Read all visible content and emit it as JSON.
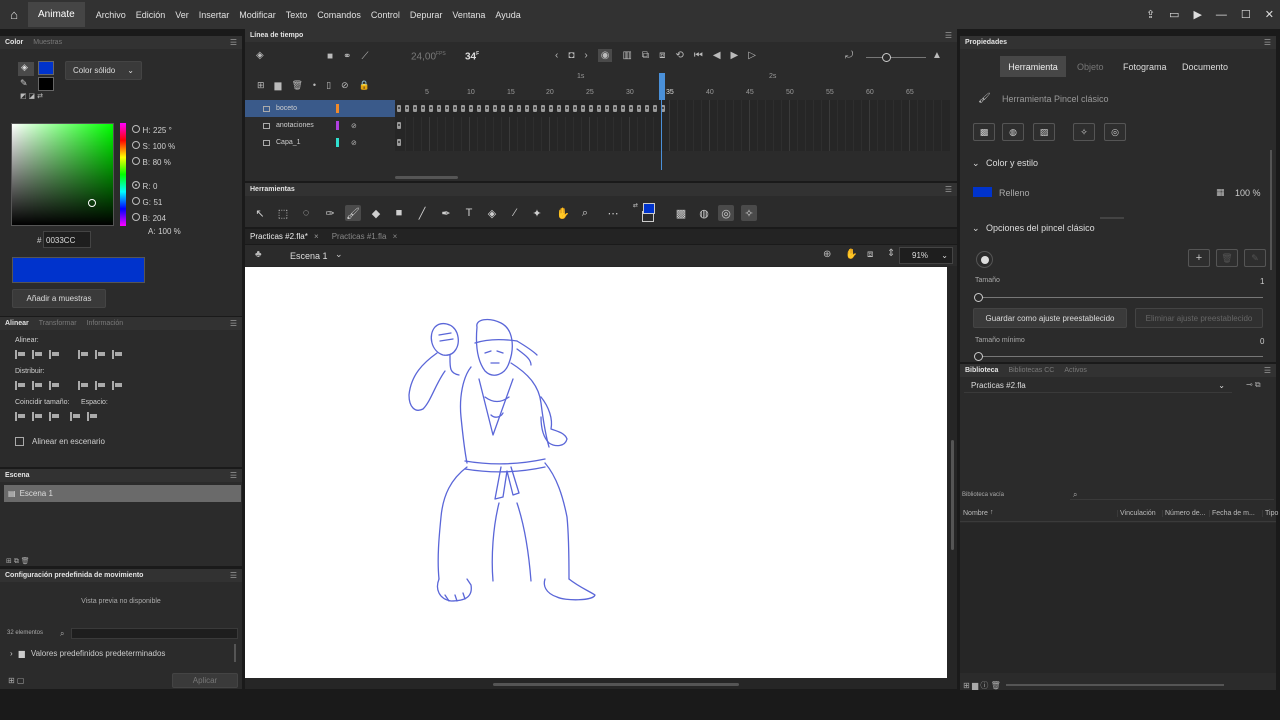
{
  "menubar": {
    "app_name": "Animate",
    "items": [
      "Archivo",
      "Edición",
      "Ver",
      "Insertar",
      "Modificar",
      "Texto",
      "Comandos",
      "Control",
      "Depurar",
      "Ventana",
      "Ayuda"
    ]
  },
  "color_panel": {
    "tabs": [
      "Color",
      "Muestras"
    ],
    "fill_type": "Color sólido",
    "hsb": {
      "h_label": "H:",
      "h": "225 °",
      "s_label": "S:",
      "s": "100 %",
      "b_label": "B:",
      "b": "80 %"
    },
    "rgb": {
      "r_label": "R:",
      "r": "0",
      "g_label": "G:",
      "g": "51",
      "b_label": "B:",
      "b": "204",
      "a_label": "A:",
      "a": "100 %"
    },
    "hex_prefix": "#",
    "hex": "0033CC",
    "add_button": "Añadir a muestras",
    "fill_color": "#0033cc"
  },
  "align_panel": {
    "tabs": [
      "Alinear",
      "Transformar",
      "Información"
    ],
    "align_label": "Alinear:",
    "distribute_label": "Distribuir:",
    "match_label": "Coincidir tamaño:",
    "space_label": "Espacio:",
    "stage_checkbox": "Alinear en escenario"
  },
  "scene_panel": {
    "title": "Escena",
    "items": [
      "Escena 1"
    ]
  },
  "motion_panel": {
    "title": "Configuración predefinida de movimiento",
    "preview": "Vista previa no disponible",
    "count": "32 elementos",
    "folder": "Valores predefinidos predeterminados",
    "apply": "Aplicar"
  },
  "timeline": {
    "title": "Línea de tiempo",
    "fps": "24,00",
    "fps_unit": "FPS",
    "frame": "34",
    "frame_unit": "F",
    "sec_marks": [
      "1s",
      "2s"
    ],
    "numbers": [
      "5",
      "10",
      "15",
      "20",
      "25",
      "30",
      "35",
      "40",
      "45",
      "50",
      "55",
      "60",
      "65"
    ],
    "layers": [
      {
        "name": "boceto",
        "color": "#f08a2a"
      },
      {
        "name": "anotaciones",
        "color": "#b040e0"
      },
      {
        "name": "Capa_1",
        "color": "#30e0d0"
      }
    ]
  },
  "tools_panel": {
    "title": "Herramientas",
    "stroke_color": "#0033cc"
  },
  "document": {
    "tabs": [
      "Practicas #2.fla*",
      "Practicas #1.fla"
    ],
    "scene": "Escena 1",
    "zoom": "91%"
  },
  "properties": {
    "title": "Propiedades",
    "tabs": [
      "Herramienta",
      "Objeto",
      "Fotograma",
      "Documento"
    ],
    "tool_name": "Herramienta Pincel clásico",
    "color_section": "Color y estilo",
    "fill_label": "Relleno",
    "fill_pct": "100 %",
    "brush_section": "Opciones del pincel clásico",
    "size_label": "Tamaño",
    "size_value": "1",
    "save_preset": "Guardar como ajuste preestablecido",
    "delete_preset": "Eliminar ajuste preestablecido",
    "min_size_label": "Tamaño mínimo",
    "min_size_value": "0"
  },
  "library": {
    "tabs": [
      "Biblioteca",
      "Bibliotecas CC",
      "Activos"
    ],
    "file": "Practicas #2.fla",
    "empty": "Biblioteca vacía",
    "columns": [
      "Nombre",
      "Vinculación",
      "Número de...",
      "Fecha de m...",
      "Tipo"
    ]
  }
}
